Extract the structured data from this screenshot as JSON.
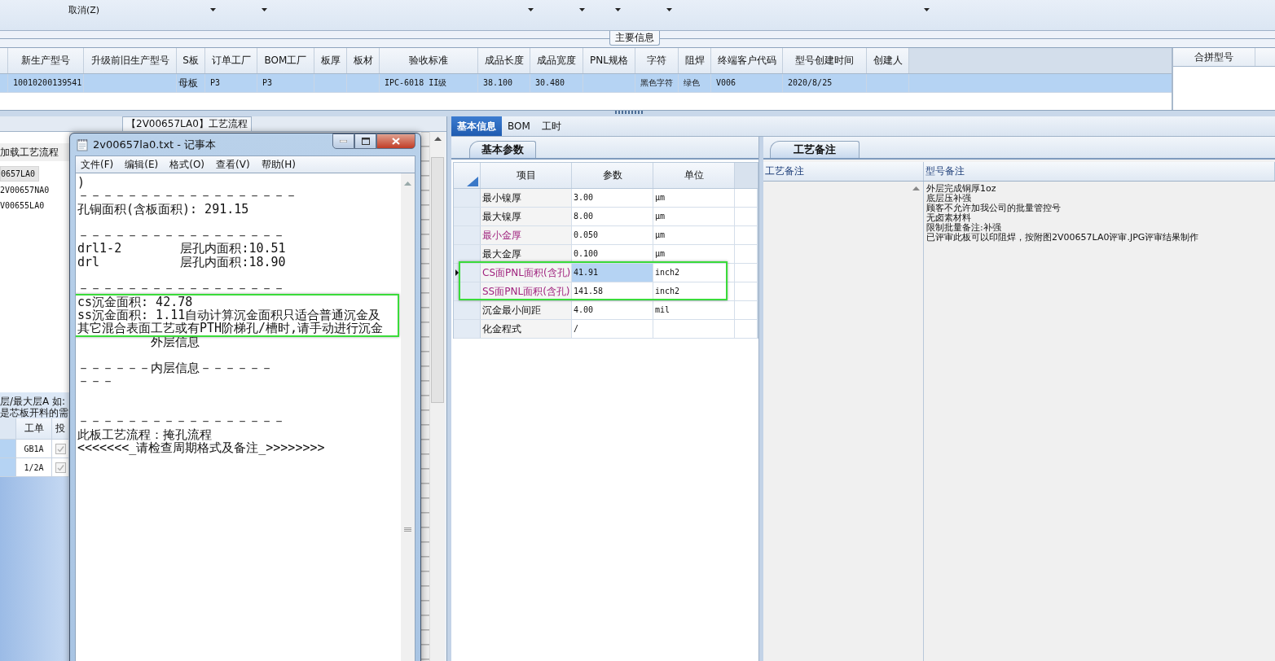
{
  "toolbar": {
    "cancel_label": "取消(Z)"
  },
  "main_info": {
    "section_title": "主要信息",
    "table": {
      "columns": [
        "新生产型号",
        "升级前旧生产型号",
        "S板",
        "订单工厂",
        "BOM工厂",
        "板厚",
        "板材",
        "验收标准",
        "成品长度",
        "成品宽度",
        "PNL规格",
        "字符",
        "阻焊",
        "终端客户代码",
        "型号创建时间",
        "创建人"
      ],
      "rows": [
        {
          "selected": true,
          "cells": [
            "10010200139541",
            null,
            "母板",
            "P3",
            "P3",
            null,
            null,
            "IPC-6018 II级",
            "38.100",
            "30.480",
            null,
            "黑色字符",
            "绿色",
            "V006",
            "2020/8/25",
            null
          ]
        }
      ]
    },
    "merge_table": {
      "columns": [
        "合拼型号"
      ]
    }
  },
  "process_panel": {
    "tab": "【2V00657LA0】工艺流程",
    "load_button": "加载工艺流程",
    "models": [
      {
        "label": "0657LA0",
        "selected": true
      },
      {
        "label": "2V00657NA0",
        "selected": false
      },
      {
        "label": "V00655LA0",
        "selected": false
      }
    ],
    "hint_lines": [
      "层/最大层A 如:",
      "是芯板开料的需"
    ],
    "table": {
      "columns": [
        "工单",
        "投"
      ],
      "rows": [
        {
          "order": "GB1A",
          "checked": true
        },
        {
          "order": "1/2A",
          "checked": true
        }
      ]
    }
  },
  "notepad": {
    "title": "2v00657la0.txt - 记事本",
    "menu": [
      "文件(F)",
      "编辑(E)",
      "格式(O)",
      "查看(V)",
      "帮助(H)"
    ],
    "lines": [
      {
        "kind": "text",
        "text": ")"
      },
      {
        "kind": "text",
        "text": "－－－－－－－－－－－－－－－－－－"
      },
      {
        "kind": "text",
        "text": "孔铜面积(含板面积): 291.15"
      },
      {
        "kind": "blank"
      },
      {
        "kind": "text",
        "text": "－－－－－－－－－－－－－－－－－"
      },
      {
        "kind": "text",
        "text": "drl1-2        层孔内面积:10.51"
      },
      {
        "kind": "text",
        "text": "drl           层孔内面积:18.90"
      },
      {
        "kind": "blank"
      },
      {
        "kind": "text",
        "text": "－－－－－－－－－－－－－－－－－"
      },
      {
        "kind": "highlight",
        "lines": [
          {
            "kind": "text",
            "text": "cs沉金面积: 42.78"
          },
          {
            "kind": "text",
            "text": "ss沉金面积: 1.11自动计算沉金面积只适合普通沉金及"
          },
          {
            "kind": "text",
            "text": "其它混合表面工艺或有PTH阶梯孔/槽时,请手动进行沉金"
          }
        ]
      },
      {
        "kind": "text",
        "text": "          外层信息"
      },
      {
        "kind": "blank"
      },
      {
        "kind": "text",
        "text": "－－－－－－内层信息－－－－－－"
      },
      {
        "kind": "text",
        "text": "－－－"
      },
      {
        "kind": "blank"
      },
      {
        "kind": "blank"
      },
      {
        "kind": "text",
        "text": "－－－－－－－－－－－－－－－－－"
      },
      {
        "kind": "text",
        "text": "此板工艺流程：掩孔流程"
      },
      {
        "kind": "text",
        "text": "<<<<<<<_请检查周期格式及备注_>>>>>>>>"
      }
    ]
  },
  "detail": {
    "tabs": [
      {
        "label": "基本信息",
        "selected": true
      },
      {
        "label": "BOM",
        "selected": false
      },
      {
        "label": "工时",
        "selected": false
      }
    ],
    "params": {
      "tab": "基本参数",
      "columns": [
        "项目",
        "参数",
        "单位"
      ],
      "rows": [
        {
          "kind": "row",
          "item": "最小镍厚",
          "value": "3.00",
          "unit": "μm",
          "emphasized": false,
          "selected": false
        },
        {
          "kind": "row",
          "item": "最大镍厚",
          "value": "8.00",
          "unit": "μm",
          "emphasized": false,
          "selected": false
        },
        {
          "kind": "row",
          "item": "最小金厚",
          "value": "0.050",
          "unit": "μm",
          "emphasized": true,
          "selected": false
        },
        {
          "kind": "row",
          "item": "最大金厚",
          "value": "0.100",
          "unit": "μm",
          "emphasized": false,
          "selected": false
        },
        {
          "kind": "highlight",
          "rows": [
            {
              "kind": "row",
              "item": "CS面PNL面积(含孔)",
              "value": "41.91",
              "unit": "inch2",
              "emphasized": true,
              "selected": true
            },
            {
              "kind": "row",
              "item": "SS面PNL面积(含孔)",
              "value": "141.58",
              "unit": "inch2",
              "emphasized": true,
              "selected": false
            }
          ]
        },
        {
          "kind": "row",
          "item": "沉金最小间距",
          "value": "4.00",
          "unit": "mil",
          "emphasized": false,
          "selected": false
        },
        {
          "kind": "row",
          "item": "化金程式",
          "value": "/",
          "emphasized": false,
          "selected": false
        }
      ]
    },
    "notes": {
      "tab": "工艺备注",
      "columns": [
        "工艺备注",
        "型号备注"
      ],
      "model_notes": [
        "外层完成铜厚1oz",
        "底层压补强",
        "顾客不允许加我公司的批量管控号",
        "无卤素材料",
        "限制批量备注:补强",
        "已评审此板可以印阻焊，按附图2V00657LA0评审.JPG评审结果制作"
      ]
    }
  }
}
